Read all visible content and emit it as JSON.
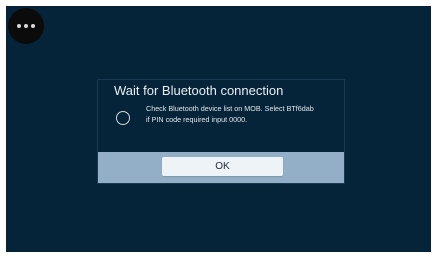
{
  "menu": {
    "icon": "more-horizontal-icon"
  },
  "dialog": {
    "title": "Wait for Bluetooth connection",
    "message_line1": "Check Bluetooth device list on MOB. Select BTf6dab",
    "message_line2": "if PIN code required input 0000.",
    "spinner_icon": "loading-spinner-icon",
    "ok_label": "OK"
  },
  "colors": {
    "background": "#05243a",
    "button_bar": "#93afc8",
    "ok_button": "#eef3f7"
  }
}
